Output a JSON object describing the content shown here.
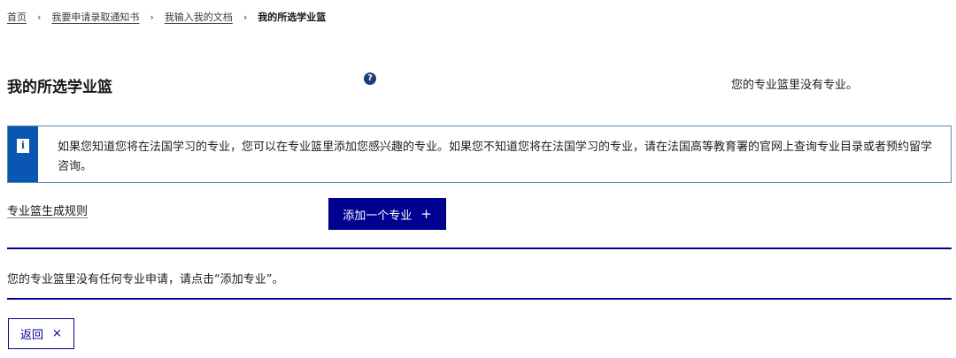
{
  "breadcrumb": {
    "items": [
      "首页",
      "我要申请录取通知书",
      "我输入我的文档"
    ],
    "current": "我的所选学业篮",
    "separator": "›"
  },
  "header": {
    "title": "我的所选学业篮",
    "help_icon": "question-circle-icon",
    "status": "您的专业篮里没有专业。"
  },
  "notice": {
    "icon": "info-icon",
    "text": "如果您知道您将在法国学习的专业，您可以在专业篮里添加您感兴趣的专业。如果您不知道您将在法国学习的专业，请在法国高等教育署的官网上查询专业目录或者预约留学咨询。"
  },
  "rules_link": "专业篮生成规则",
  "add_button": {
    "label": "添加一个专业",
    "icon": "+"
  },
  "empty_message": "您的专业篮里没有任何专业申请，请点击“添加专业”。",
  "back_button": {
    "label": "返回",
    "icon": "×"
  },
  "colors": {
    "primary": "#000091",
    "info": "#0a56b3",
    "notice_border": "#5d8aa8"
  }
}
